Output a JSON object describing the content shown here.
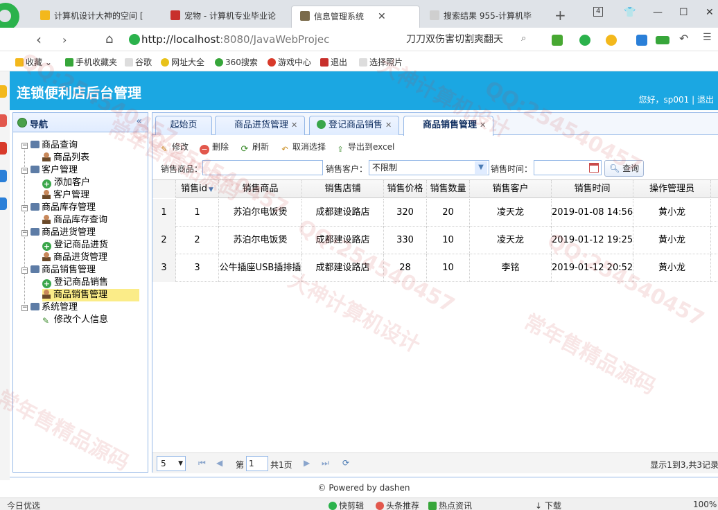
{
  "browser": {
    "tabs": [
      {
        "label": "计算机设计大神的空间 [",
        "icon_color": "#f3b81c"
      },
      {
        "label": "宠物 - 计算机专业毕业论",
        "icon_color": "#c8302c"
      },
      {
        "label": "信息管理系统",
        "icon_color": "#7a6a4a"
      },
      {
        "label": "搜索结果 955-计算机毕",
        "icon_color": "#cfcfcf"
      }
    ],
    "tab_count": "4",
    "url_host": "http://localhost",
    "url_rest": ":8080/JavaWebProjec",
    "search_text": "刀刀双伤害切割爽翻天",
    "bookmarks": [
      "收藏",
      "手机收藏夹",
      "谷歌",
      "网址大全",
      "360搜索",
      "游戏中心",
      "退出",
      "选择照片"
    ]
  },
  "app": {
    "title": "连锁便利店后台管理",
    "user_text": "您好，sp001 | 退出"
  },
  "nav": {
    "title": "导航",
    "groups": [
      {
        "label": "商品查询",
        "items": [
          "商品列表"
        ]
      },
      {
        "label": "客户管理",
        "items": [
          "添加客户",
          "客户管理"
        ]
      },
      {
        "label": "商品库存管理",
        "items": [
          "商品库存查询"
        ]
      },
      {
        "label": "商品进货管理",
        "items": [
          "登记商品进货",
          "商品进货管理"
        ]
      },
      {
        "label": "商品销售管理",
        "items": [
          "登记商品销售",
          "商品销售管理"
        ]
      },
      {
        "label": "系统管理",
        "items": [
          "修改个人信息"
        ]
      }
    ]
  },
  "tabs": [
    "起始页",
    "商品进货管理",
    "登记商品销售",
    "商品销售管理"
  ],
  "toolbar": {
    "edit": "修改",
    "delete": "删除",
    "refresh": "刷新",
    "cancel_select": "取消选择",
    "export": "导出到excel"
  },
  "filters": {
    "product_label": "销售商品：",
    "product_value": "",
    "customer_label": "销售客户：",
    "customer_value": "不限制",
    "time_label": "销售时间：",
    "time_value": "",
    "query_button": "查询"
  },
  "grid": {
    "columns": [
      "销售id",
      "销售商品",
      "销售店铺",
      "销售价格",
      "销售数量",
      "销售客户",
      "销售时间",
      "操作管理员"
    ],
    "rows": [
      {
        "num": "1",
        "id": "1",
        "product": "苏泊尔电饭煲",
        "store": "成都建设路店",
        "price": "320",
        "qty": "20",
        "customer": "凌天龙",
        "time": "2019-01-08 14:56:",
        "admin": "黄小龙"
      },
      {
        "num": "2",
        "id": "2",
        "product": "苏泊尔电饭煲",
        "store": "成都建设路店",
        "price": "330",
        "qty": "10",
        "customer": "凌天龙",
        "time": "2019-01-12 19:25:",
        "admin": "黄小龙"
      },
      {
        "num": "3",
        "id": "3",
        "product": "公牛插座USB插排插",
        "store": "成都建设路店",
        "price": "28",
        "qty": "10",
        "customer": "李铭",
        "time": "2019-01-12 20:52:",
        "admin": "黄小龙"
      }
    ]
  },
  "pager": {
    "page_size": "5",
    "page_label": "第",
    "page_value": "1",
    "total_pages": "共1页",
    "info": "显示1到3,共3记录"
  },
  "footer": "© Powered by dashen",
  "statusbar": {
    "left": "今日优选",
    "items": [
      "快剪辑",
      "头条推荐",
      "热点资讯",
      "下载"
    ],
    "zoom": "100%"
  },
  "watermarks": [
    "QQ:254540457",
    "大神计算机设计",
    "常年售精品源码"
  ]
}
